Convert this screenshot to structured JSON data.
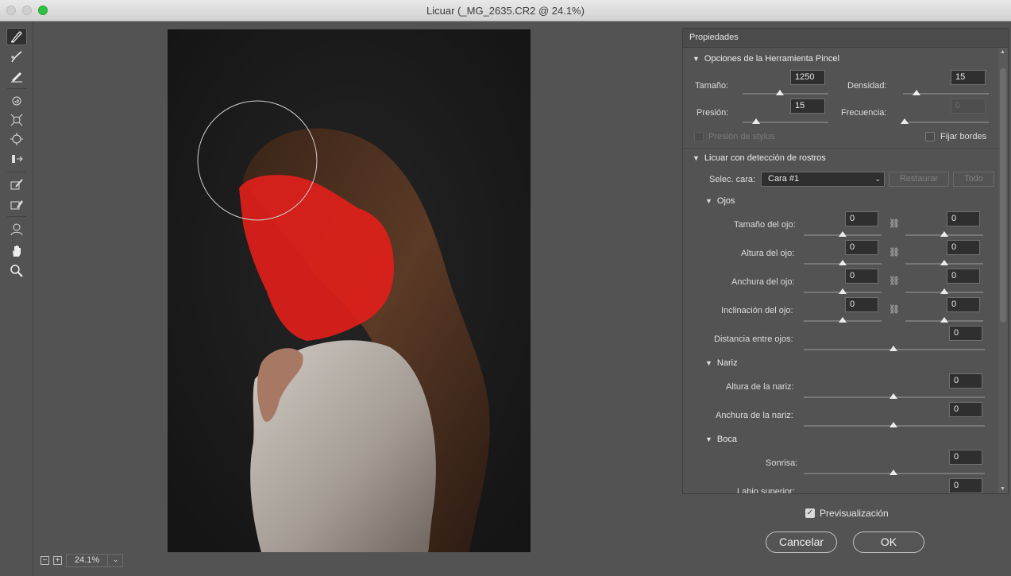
{
  "window": {
    "title": "Licuar (_MG_2635.CR2 @ 24.1%)"
  },
  "toolbar": {
    "tools": [
      "forward-warp-icon",
      "reconstruct-icon",
      "smooth-icon",
      "twirl-icon",
      "pucker-icon",
      "bloat-icon",
      "push-left-icon",
      "freeze-mask-icon",
      "thaw-mask-icon",
      "face-tool-icon",
      "hand-icon",
      "zoom-icon"
    ]
  },
  "canvas": {
    "zoom": "24.1%"
  },
  "panel": {
    "title": "Propiedades",
    "brush": {
      "section": "Opciones de la Herramienta Pincel",
      "size_label": "Tamaño:",
      "size_value": "1250",
      "density_label": "Densidad:",
      "density_value": "15",
      "pressure_label": "Presión:",
      "pressure_value": "15",
      "rate_label": "Frecuencia:",
      "rate_value": "0",
      "stylus_label": "Presión de stylus",
      "pin_label": "Fijar bordes"
    },
    "face": {
      "section": "Licuar con detección de rostros",
      "select_label": "Selec. cara:",
      "select_value": "Cara #1",
      "reset_label": "Restaurar",
      "all_label": "Todo",
      "eyes": {
        "section": "Ojos",
        "rows": [
          {
            "label": "Tamaño del ojo:",
            "left": "0",
            "right": "0"
          },
          {
            "label": "Altura del ojo:",
            "left": "0",
            "right": "0"
          },
          {
            "label": "Anchura del ojo:",
            "left": "0",
            "right": "0"
          },
          {
            "label": "Inclinación del ojo:",
            "left": "0",
            "right": "0"
          }
        ],
        "distance_label": "Distancia entre ojos:",
        "distance_value": "0"
      },
      "nose": {
        "section": "Nariz",
        "height_label": "Altura de la nariz:",
        "height_value": "0",
        "width_label": "Anchura de la nariz:",
        "width_value": "0"
      },
      "mouth": {
        "section": "Boca",
        "smile_label": "Sonrisa:",
        "smile_value": "0",
        "upper_lip_label": "Labio superior:",
        "upper_lip_value": "0"
      }
    }
  },
  "footer": {
    "preview_label": "Previsualización",
    "cancel_label": "Cancelar",
    "ok_label": "OK"
  },
  "colors": {
    "mask": "#e0201a",
    "panel_bg": "#535353",
    "field_bg": "#2f2f2f"
  }
}
